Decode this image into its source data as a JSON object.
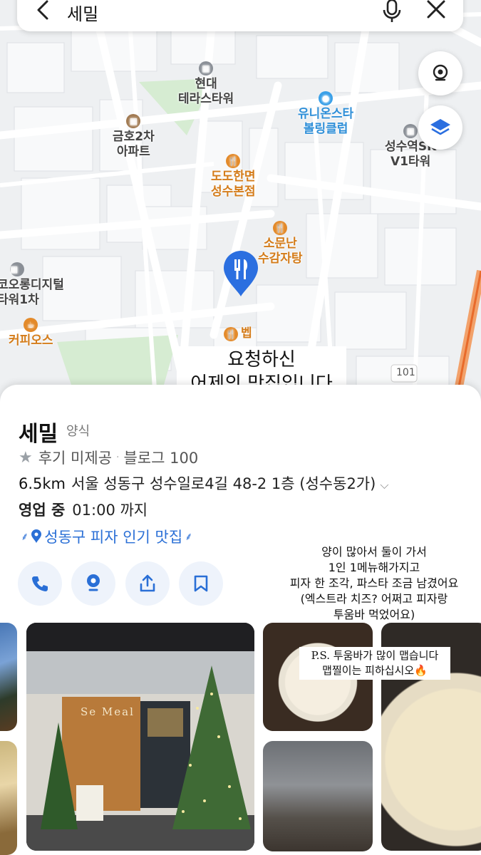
{
  "search": {
    "query": "세밀",
    "back_icon": "chevron-left-icon",
    "mic_icon": "microphone-icon",
    "close_icon": "close-icon"
  },
  "map": {
    "pois": [
      {
        "label": "현대\n테라스타워",
        "type": "building"
      },
      {
        "label": "유니온스타\n볼링클럽",
        "type": "leisure"
      },
      {
        "label": "금호2차\n아파트",
        "type": "apartment"
      },
      {
        "label": "성수역SK\nV1타워",
        "type": "building"
      },
      {
        "label": "도도한면\n성수본점",
        "type": "restaurant"
      },
      {
        "label": "소문난\n수감자탕",
        "type": "restaurant"
      },
      {
        "label": "코오롱디지털\n타워1차",
        "type": "building"
      },
      {
        "label": "커피오스",
        "type": "cafe"
      },
      {
        "label": "벱",
        "type": "restaurant"
      }
    ],
    "road_number": "101",
    "selected_pin_icon": "fork-knife-pin-icon",
    "location_icon": "location-target-icon",
    "layers_icon": "layers-icon"
  },
  "overlay_caption": {
    "line1": "요청하신",
    "line2": "어제의 맛집입니다"
  },
  "place": {
    "name": "세밀",
    "category": "양식",
    "rating_text": "후기 미제공",
    "blog_text": "블로그 100",
    "distance": "6.5km",
    "address": "서울 성동구 성수일로4길 48-2 1층 (성수동2가)",
    "status": "영업 중",
    "hours": "01:00 까지",
    "popular_tag": "성동구 피자 인기 맛집"
  },
  "actions": [
    {
      "name": "call",
      "icon": "phone-icon"
    },
    {
      "name": "map",
      "icon": "map-pin-icon"
    },
    {
      "name": "share",
      "icon": "share-icon"
    },
    {
      "name": "save",
      "icon": "bookmark-icon"
    }
  ],
  "review_note": {
    "line1": "양이 많아서 둘이 가서",
    "line2": "1인 1메뉴해가지고",
    "line3": "피자 한 조각, 파스타 조금 남겼어요",
    "line4": "(엑스트라 치즈? 어쩌고 피자랑",
    "line5": "투움바 먹었어요)"
  },
  "ps_note": {
    "line1": "P.S. 투움바가 많이 맵습니다",
    "line2": "맵찔이는 피하십시오🔥"
  },
  "photos": {
    "storefront_sign": "Se Meal"
  },
  "colors": {
    "accent_blue": "#2a6fd6",
    "poi_orange": "#e38a2a",
    "poi_blue": "#3aa0e8"
  }
}
